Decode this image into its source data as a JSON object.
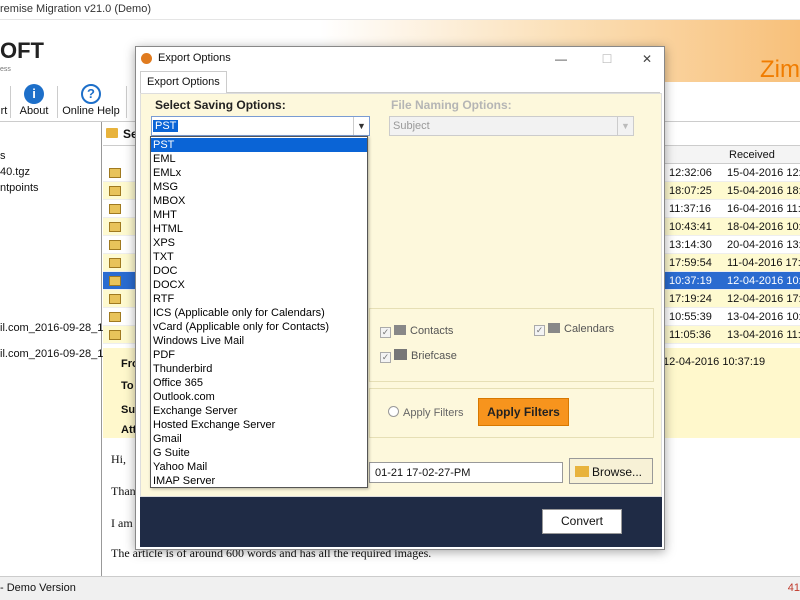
{
  "app": {
    "title": "remise Migration v21.0 (Demo)",
    "logo": "OFT",
    "logo_tagline": "ess",
    "brand_right": "Zim",
    "toolbar": [
      {
        "label": "rt",
        "icon": "partial-icon"
      },
      {
        "label": "About",
        "icon": "info-icon"
      },
      {
        "label": "Online Help",
        "icon": "help-icon"
      }
    ]
  },
  "left_panel": {
    "items": [
      "s",
      "40.tgz",
      "ntpoints",
      "il.com_2016-09-28_113",
      "il.com_2016-09-28_113"
    ]
  },
  "mail_list": {
    "folder_title": "Se",
    "columns": {
      "received": "Received"
    },
    "rows": [
      {
        "time": "12:32:06",
        "received": "15-04-2016 12:3",
        "style": "white"
      },
      {
        "time": "18:07:25",
        "received": "15-04-2016 18:0",
        "style": "yellow"
      },
      {
        "time": "11:37:16",
        "received": "16-04-2016 11:3",
        "style": "white"
      },
      {
        "time": "10:43:41",
        "received": "18-04-2016 10:4",
        "style": "yellow"
      },
      {
        "time": "13:14:30",
        "received": "20-04-2016 13:1",
        "style": "white"
      },
      {
        "time": "17:59:54",
        "received": "11-04-2016 17:5",
        "style": "yellow"
      },
      {
        "time": "10:37:19",
        "received": "12-04-2016 10:3",
        "style": "selected"
      },
      {
        "time": "17:19:24",
        "received": "12-04-2016 17:1",
        "style": "yellow"
      },
      {
        "time": "10:55:39",
        "received": "13-04-2016 10:5",
        "style": "white"
      },
      {
        "time": "11:05:36",
        "received": "13-04-2016 11:0",
        "style": "yellow"
      }
    ]
  },
  "preview": {
    "labels": [
      "Fro",
      "To",
      "Sub",
      "Att"
    ],
    "date": "12-04-2016 10:37:19",
    "body_lines": [
      "Hi,",
      "Than",
      "I am",
      "The article is of around 600 words and has all the required images."
    ]
  },
  "status": {
    "left": "- Demo Version",
    "right": "41"
  },
  "dialog": {
    "title": "Export Options",
    "tab": "Export Options",
    "select_saving_label": "Select Saving Options:",
    "file_naming_label": "File Naming Options:",
    "selected_format": "PST",
    "file_naming_value": "Subject",
    "formats": [
      "PST",
      "EML",
      "EMLx",
      "MSG",
      "MBOX",
      "MHT",
      "HTML",
      "XPS",
      "TXT",
      "DOC",
      "DOCX",
      "RTF",
      "ICS (Applicable only for Calendars)",
      "vCard (Applicable only for Contacts)",
      "Windows Live Mail",
      "PDF",
      "Thunderbird",
      "Office 365",
      "Outlook.com",
      "Exchange Server",
      "Hosted Exchange Server",
      "Gmail",
      "G Suite",
      "Yahoo Mail",
      "IMAP Server"
    ],
    "checkboxes": {
      "contacts": "Contacts",
      "calendars": "Calendars",
      "briefcase": "Briefcase"
    },
    "apply_filters_radio": "Apply Filters",
    "apply_filters_button": "Apply Filters",
    "path_value": "01-21 17-02-27-PM",
    "browse_button": "Browse...",
    "convert_button": "Convert",
    "window_buttons": {
      "minimize": "—",
      "maximize": "☐",
      "close": "✕"
    }
  },
  "colors": {
    "accent_orange": "#f7941d",
    "selection_blue": "#0a64d6",
    "dialog_bg": "#fdf8dc",
    "footer_navy": "#1f2b45"
  }
}
